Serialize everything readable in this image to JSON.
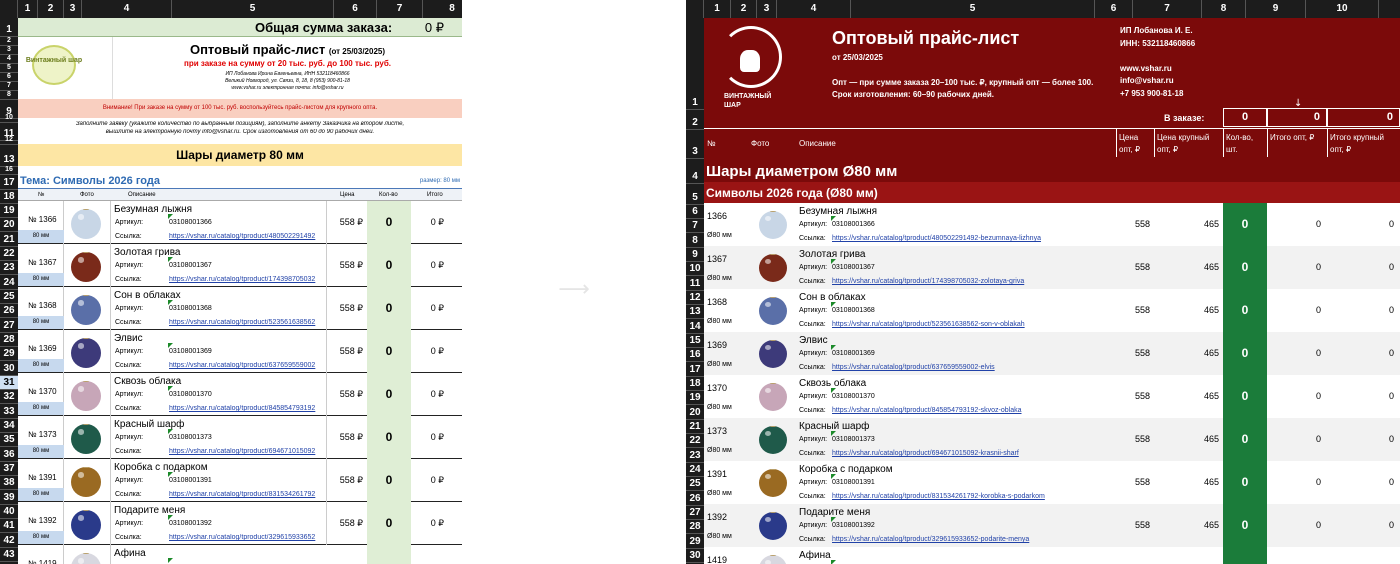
{
  "columns_left": [
    "1",
    "2",
    "3",
    "4",
    "5",
    "6",
    "7",
    "8"
  ],
  "columns_right": [
    "1",
    "2",
    "3",
    "4",
    "5",
    "6",
    "7",
    "8",
    "9",
    "10"
  ],
  "left": {
    "total_label": "Общая сумма заказа:",
    "total_value": "0 ₽",
    "logo_text": "Винтажный шар",
    "title": "Оптовый прайс-лист",
    "date": "(от 25/03/2025)",
    "promo": "при заказе на сумму от 20 тыс. руб. до 100 тыс. руб.",
    "seller": "ИП Лобанова Ирина Евгеньевна, ИНН 532118460866",
    "address": "Великий Новгород, ул. Связи, 8, 18, 8 (953) 900-81-18",
    "site": "www.vshar.ru    электронная почта: info@vshar.ru",
    "warning": "Внимание! При заказе на сумму от 100 тыс. руб. воспользуйтесь прайс-листом для крупного опта.",
    "instruction1": "Заполните заявку (укажите количество по выбранным позициям), заполните анкету Заказчика на втором листе,",
    "instruction2": "вышлите на электронную почту info@vshar.ru. Срок изготовления от 60 до 90 рабочих дней.",
    "section": "Шары диаметр 80 мм",
    "theme": "Тема: Символы 2026 года",
    "size_note": "размер: 80 мм",
    "headers": {
      "num": "№",
      "photo": "Фото",
      "desc": "Описание",
      "price": "Цена",
      "qty": "Кол-во",
      "total": "Итого"
    },
    "art_label": "Артикул:",
    "link_label": "Ссылка:",
    "size_tag": "80 мм",
    "row_numbers": [
      "1",
      "2",
      "3",
      "4",
      "5",
      "6",
      "7",
      "8",
      "9",
      "10",
      "11",
      "12",
      "13",
      "16",
      "17",
      "18",
      "19",
      "20",
      "21",
      "22",
      "23",
      "24",
      "25",
      "26",
      "27",
      "28",
      "29",
      "30",
      "31",
      "32",
      "33",
      "34",
      "35",
      "36",
      "37",
      "38",
      "39",
      "40",
      "41",
      "42",
      "43"
    ],
    "items": [
      {
        "num": "№ 1366",
        "name": "Безумная лыжня",
        "art": "03108001366",
        "link": "https://vshar.ru/catalog/tproduct/480502291492",
        "price": "558 ₽",
        "qty": "0",
        "total": "0 ₽"
      },
      {
        "num": "№ 1367",
        "name": "Золотая грива",
        "art": "03108001367",
        "link": "https://vshar.ru/catalog/tproduct/174398705032",
        "price": "558 ₽",
        "qty": "0",
        "total": "0 ₽"
      },
      {
        "num": "№ 1368",
        "name": "Сон в облаках",
        "art": "03108001368",
        "link": "https://vshar.ru/catalog/tproduct/523561638562",
        "price": "558 ₽",
        "qty": "0",
        "total": "0 ₽"
      },
      {
        "num": "№ 1369",
        "name": "Элвис",
        "art": "03108001369",
        "link": "https://vshar.ru/catalog/tproduct/637659559002",
        "price": "558 ₽",
        "qty": "0",
        "total": "0 ₽"
      },
      {
        "num": "№ 1370",
        "name": "Сквозь облака",
        "art": "03108001370",
        "link": "https://vshar.ru/catalog/tproduct/845854793192",
        "price": "558 ₽",
        "qty": "0",
        "total": "0 ₽"
      },
      {
        "num": "№ 1373",
        "name": "Красный шарф",
        "art": "03108001373",
        "link": "https://vshar.ru/catalog/tproduct/694671015092",
        "price": "558 ₽",
        "qty": "0",
        "total": "0 ₽"
      },
      {
        "num": "№ 1391",
        "name": "Коробка с подарком",
        "art": "03108001391",
        "link": "https://vshar.ru/catalog/tproduct/831534261792",
        "price": "558 ₽",
        "qty": "0",
        "total": "0 ₽"
      },
      {
        "num": "№ 1392",
        "name": "Подарите меня",
        "art": "03108001392",
        "link": "https://vshar.ru/catalog/tproduct/329615933652",
        "price": "558 ₽",
        "qty": "0",
        "total": "0 ₽"
      },
      {
        "num": "№ 1419",
        "name": "Афина",
        "art": "",
        "link": "",
        "price": "",
        "qty": "",
        "total": ""
      }
    ]
  },
  "right": {
    "logo_text": "ВИНТАЖНЫЙ ШАР",
    "title": "Оптовый прайс-лист",
    "date": "от 25/03/2025",
    "terms": "Опт — при сумме заказа 20–100 тыс. ₽, крупный опт — более 100.",
    "lead_time": "Срок изготовления: 60–90 рабочих дней.",
    "seller": "ИП Лобанова И. Е.",
    "inn": "ИНН: 532118460866",
    "site": "www.vshar.ru",
    "email": "info@vshar.ru",
    "phone": "+7 953 900-81-18",
    "arrow": "↓",
    "in_order_label": "В заказе:",
    "sum_qty": "0",
    "sum_total": "0",
    "sum_big": "0",
    "headers": {
      "num": "№",
      "photo": "Фото",
      "desc": "Описание",
      "price": "Цена опт, ₽",
      "price_big": "Цена крупный опт, ₽",
      "qty": "Кол-во, шт.",
      "total": "Итого опт, ₽",
      "total_big": "Итого крупный опт, ₽"
    },
    "section": "Шары диаметром Ø80 мм",
    "subsection": "Символы 2026 года (Ø80 мм)",
    "art_label": "Артикул:",
    "link_label": "Ссылка:",
    "size_tag": "Ø80 мм",
    "row_numbers": [
      "1",
      "2",
      "3",
      "4",
      "5",
      "6",
      "7",
      "8",
      "9",
      "10",
      "11",
      "12",
      "13",
      "14",
      "15",
      "16",
      "17",
      "18",
      "19",
      "20",
      "21",
      "22",
      "23",
      "24",
      "25",
      "26",
      "27",
      "28",
      "29",
      "30",
      "31"
    ],
    "items": [
      {
        "num": "1366",
        "name": "Безумная лыжня",
        "art": "03108001366",
        "link": "https://vshar.ru/catalog/tproduct/480502291492-bezumnaya-lizhnya",
        "price": "558",
        "price_big": "465",
        "qty": "0",
        "total": "0",
        "total_big": "0"
      },
      {
        "num": "1367",
        "name": "Золотая грива",
        "art": "03108001367",
        "link": "https://vshar.ru/catalog/tproduct/174398705032-zolotaya-griva",
        "price": "558",
        "price_big": "465",
        "qty": "0",
        "total": "0",
        "total_big": "0"
      },
      {
        "num": "1368",
        "name": "Сон в облаках",
        "art": "03108001368",
        "link": "https://vshar.ru/catalog/tproduct/523561638562-son-v-oblakah",
        "price": "558",
        "price_big": "465",
        "qty": "0",
        "total": "0",
        "total_big": "0"
      },
      {
        "num": "1369",
        "name": "Элвис",
        "art": "03108001369",
        "link": "https://vshar.ru/catalog/tproduct/637659559002-elvis",
        "price": "558",
        "price_big": "465",
        "qty": "0",
        "total": "0",
        "total_big": "0"
      },
      {
        "num": "1370",
        "name": "Сквозь облака",
        "art": "03108001370",
        "link": "https://vshar.ru/catalog/tproduct/845854793192-skvoz-oblaka",
        "price": "558",
        "price_big": "465",
        "qty": "0",
        "total": "0",
        "total_big": "0"
      },
      {
        "num": "1373",
        "name": "Красный шарф",
        "art": "03108001373",
        "link": "https://vshar.ru/catalog/tproduct/694671015092-krasnii-sharf",
        "price": "558",
        "price_big": "465",
        "qty": "0",
        "total": "0",
        "total_big": "0"
      },
      {
        "num": "1391",
        "name": "Коробка с подарком",
        "art": "03108001391",
        "link": "https://vshar.ru/catalog/tproduct/831534261792-korobka-s-podarkom",
        "price": "558",
        "price_big": "465",
        "qty": "0",
        "total": "0",
        "total_big": "0"
      },
      {
        "num": "1392",
        "name": "Подарите меня",
        "art": "03108001392",
        "link": "https://vshar.ru/catalog/tproduct/329615933652-podarite-menya",
        "price": "558",
        "price_big": "465",
        "qty": "0",
        "total": "0",
        "total_big": "0"
      },
      {
        "num": "1419",
        "name": "Афина",
        "art": "",
        "link": "",
        "price": "",
        "price_big": "",
        "qty": "",
        "total": "",
        "total_big": ""
      }
    ]
  },
  "ball_colors": [
    "#c8d6e6",
    "#7a2a1a",
    "#5a6fa8",
    "#3d3a7a",
    "#c7a6b8",
    "#1f5a4a",
    "#9a6a22",
    "#2a3a8a",
    "#d8d8e0"
  ]
}
